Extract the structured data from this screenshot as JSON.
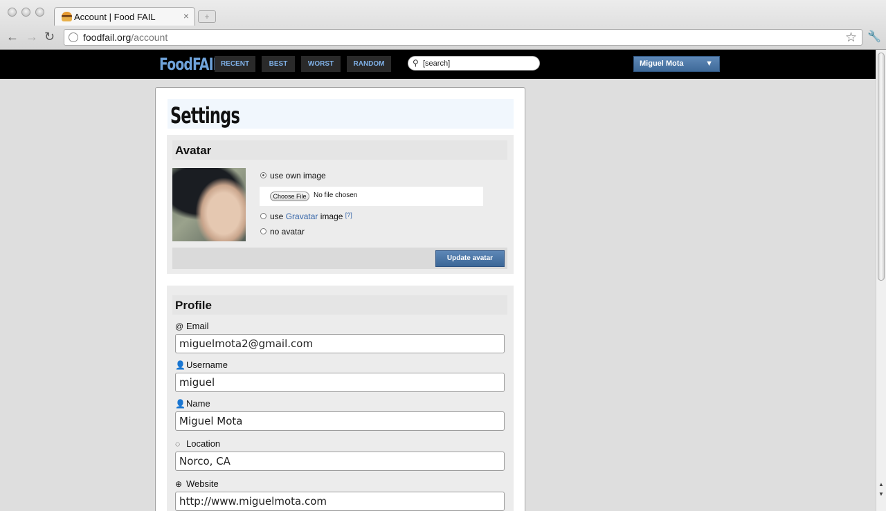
{
  "browser": {
    "tab_title": "Account | Food FAIL",
    "tab_close": "×",
    "url_host": "foodfail.org",
    "url_path": "/account"
  },
  "site": {
    "logo": "FoodFAIL",
    "nav": [
      {
        "label": "RECENT"
      },
      {
        "label": "BEST"
      },
      {
        "label": "WORST"
      },
      {
        "label": "RANDOM"
      }
    ],
    "search_value": "[search]",
    "user_menu": "Miguel Mota",
    "user_menu_caret": "▼"
  },
  "page": {
    "title": "Settings"
  },
  "avatar_section": {
    "heading": "Avatar",
    "option_own": "use own image",
    "file_button": "Choose File",
    "file_status": "No file chosen",
    "option_gravatar_prefix": "use",
    "option_gravatar_link": "Gravatar",
    "option_gravatar_suffix": "image",
    "gravatar_help": "[?]",
    "option_none": "no avatar",
    "selected": "use own image",
    "update_button": "Update avatar"
  },
  "profile_section": {
    "heading": "Profile",
    "fields": [
      {
        "label": "Email",
        "icon": "at-icon",
        "value": "miguelmota2@gmail.com"
      },
      {
        "label": "Username",
        "icon": "user-icon",
        "value": "miguel"
      },
      {
        "label": "Name",
        "icon": "user-icon",
        "value": "Miguel Mota"
      },
      {
        "label": "Location",
        "icon": "location-icon",
        "value": "Norco, CA"
      },
      {
        "label": "Website",
        "icon": "globe-icon",
        "value": "http://www.miguelmota.com"
      }
    ]
  },
  "colors": {
    "header_bg": "#000000",
    "nav_text": "#7fb0e6",
    "button_blue": "#3c6797",
    "title_bg": "#f1f7fd"
  }
}
